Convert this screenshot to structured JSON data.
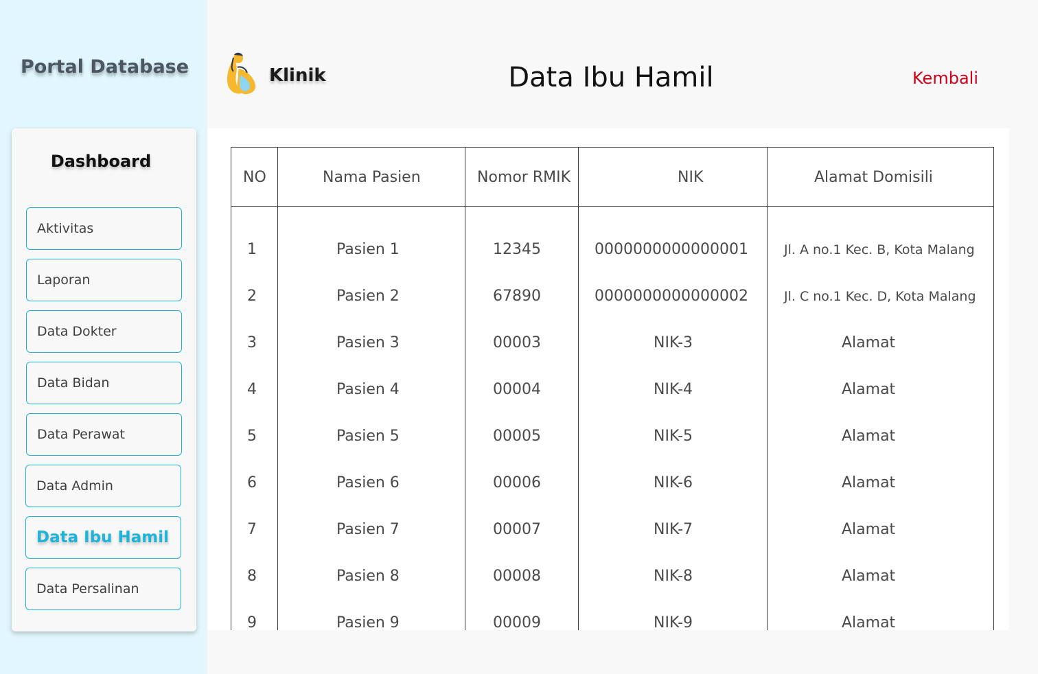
{
  "sidebar": {
    "portal_title": "Portal Database",
    "menu_heading": "Dashboard",
    "items": [
      {
        "label": "Aktivitas",
        "active": false
      },
      {
        "label": "Laporan",
        "active": false
      },
      {
        "label": "Data Dokter",
        "active": false
      },
      {
        "label": "Data Bidan",
        "active": false
      },
      {
        "label": "Data Perawat",
        "active": false
      },
      {
        "label": "Data Admin",
        "active": false
      },
      {
        "label": "Data Ibu Hamil",
        "active": true
      },
      {
        "label": "Data Persalinan",
        "active": false
      }
    ]
  },
  "header": {
    "brand": "Klinik",
    "logo_icon": "pregnant-mother-logo-icon",
    "title": "Data Ibu Hamil",
    "back_label": "Kembali"
  },
  "colors": {
    "sidebar_bg": "#e1f6fd",
    "accent": "#1fb3d8",
    "back_link": "#d0021b"
  },
  "table": {
    "columns": [
      "NO",
      "Nama Pasien",
      "Nomor RMIK",
      "NIK",
      "Alamat Domisili"
    ],
    "rows": [
      [
        "1",
        "Pasien 1",
        "12345",
        "0000000000000001",
        "Jl. A no.1 Kec. B, Kota Malang"
      ],
      [
        "2",
        "Pasien 2",
        "67890",
        "0000000000000002",
        "Jl. C no.1 Kec. D, Kota Malang"
      ],
      [
        "3",
        "Pasien 3",
        "00003",
        "NIK-3",
        "Alamat"
      ],
      [
        "4",
        "Pasien 4",
        "00004",
        "NIK-4",
        "Alamat"
      ],
      [
        "5",
        "Pasien 5",
        "00005",
        "NIK-5",
        "Alamat"
      ],
      [
        "6",
        "Pasien 6",
        "00006",
        "NIK-6",
        "Alamat"
      ],
      [
        "7",
        "Pasien 7",
        "00007",
        "NIK-7",
        "Alamat"
      ],
      [
        "8",
        "Pasien 8",
        "00008",
        "NIK-8",
        "Alamat"
      ],
      [
        "9",
        "Pasien 9",
        "00009",
        "NIK-9",
        "Alamat"
      ]
    ]
  }
}
